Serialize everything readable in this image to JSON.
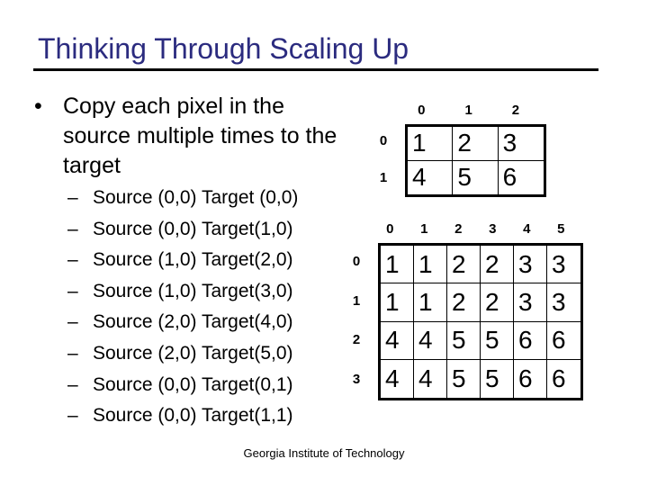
{
  "title": "Thinking Through Scaling Up",
  "bullet": {
    "text": "Copy each pixel in the source multiple times to the target"
  },
  "sub_bullets": [
    "Source (0,0) Target (0,0)",
    "Source (0,0) Target(1,0)",
    "Source (1,0) Target(2,0)",
    "Source (1,0) Target(3,0)",
    "Source (2,0) Target(4,0)",
    "Source (2,0) Target(5,0)",
    "Source (0,0) Target(0,1)",
    "Source (0,0) Target(1,1)"
  ],
  "source_grid": {
    "col_labels": [
      "0",
      "1",
      "2"
    ],
    "row_labels": [
      "0",
      "1"
    ],
    "cells": [
      [
        "1",
        "2",
        "3"
      ],
      [
        "4",
        "5",
        "6"
      ]
    ]
  },
  "target_grid": {
    "col_labels": [
      "0",
      "1",
      "2",
      "3",
      "4",
      "5"
    ],
    "row_labels": [
      "0",
      "1",
      "2",
      "3"
    ],
    "cells": [
      [
        "1",
        "1",
        "2",
        "2",
        "3",
        "3"
      ],
      [
        "1",
        "1",
        "2",
        "2",
        "3",
        "3"
      ],
      [
        "4",
        "4",
        "5",
        "5",
        "6",
        "6"
      ],
      [
        "4",
        "4",
        "5",
        "5",
        "6",
        "6"
      ]
    ]
  },
  "footer": "Georgia Institute of Technology",
  "colors": {
    "title": "#2b2b7f"
  }
}
